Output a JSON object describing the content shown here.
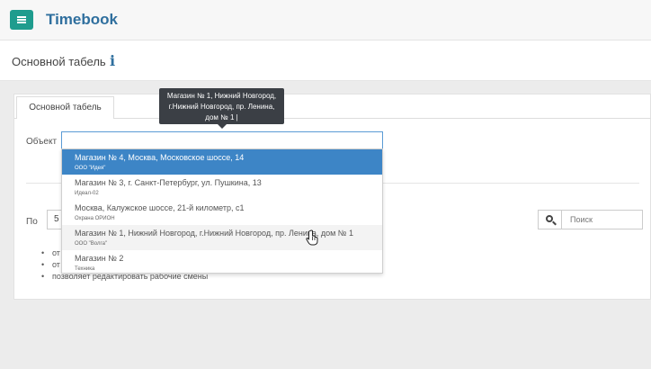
{
  "app": {
    "brand": "Timebook"
  },
  "header": {
    "page_title": "Основной табель"
  },
  "tabs": [
    {
      "label": "Основной табель"
    }
  ],
  "filters": {
    "object_label": "Объект",
    "object_value": "",
    "po_label": "По",
    "page_size": "5",
    "search_placeholder": "Поиск"
  },
  "tooltip": {
    "lines": [
      "Магазин № 1, Нижний Новгород,",
      "г.Нижний Новгород, пр. Ленина,",
      "дом № 1 |"
    ]
  },
  "dropdown": {
    "items": [
      {
        "main": "Магазин № 4, Москва, Московское шоссе, 14",
        "sub": "ООО \"Идея\"",
        "state": "selected"
      },
      {
        "main": "Магазин № 3, г. Санкт-Петербург, ул. Пушкина, 13",
        "sub": "Идеал-02",
        "state": "normal"
      },
      {
        "main": "Москва, Калужское шоссе, 21-й километр, с1",
        "sub": "Охрана ОРИОН",
        "state": "normal"
      },
      {
        "main": "Магазин № 1, Нижний Новгород, г.Нижний Новгород, пр. Ленина, дом № 1",
        "sub": "ООО \"Волга\"",
        "state": "hover"
      },
      {
        "main": "Магазин № 2",
        "sub": "Техника",
        "state": "normal"
      }
    ]
  },
  "bullets": [
    {
      "text": "от"
    },
    {
      "text": "от"
    },
    {
      "text": "позволяет редактировать рабочие смены"
    }
  ],
  "colors": {
    "accent": "#1f9c8e",
    "brand": "#2f6f9e",
    "selected": "#3d85c6"
  }
}
